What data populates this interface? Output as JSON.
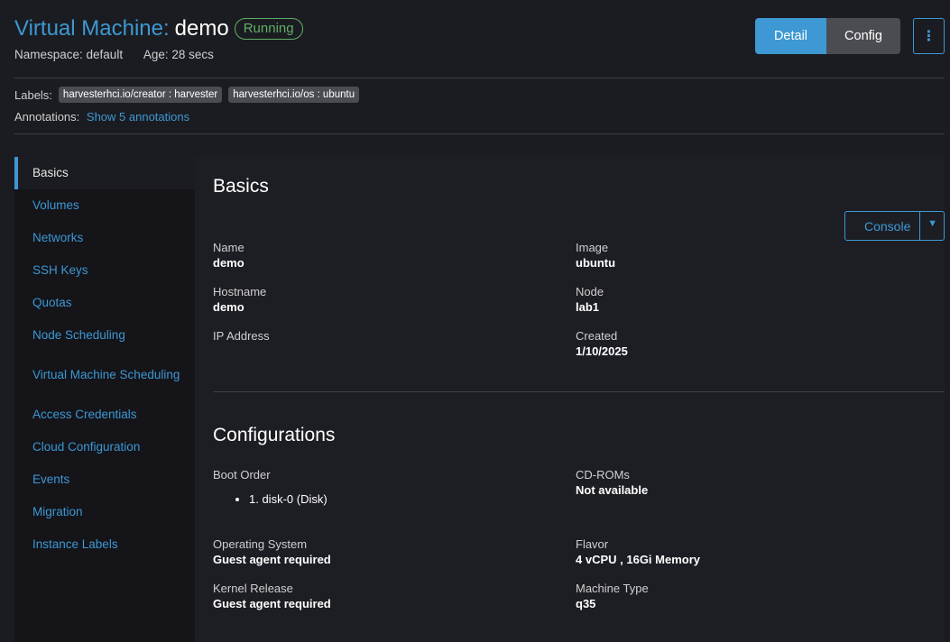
{
  "header": {
    "title_prefix": "Virtual Machine:",
    "title_name": "demo",
    "state": "Running",
    "namespace": "Namespace: default",
    "age": "Age: 28 secs"
  },
  "actions": {
    "detail": "Detail",
    "config": "Config",
    "more_icon": "⋮"
  },
  "labels": {
    "label": "Labels:",
    "chips": [
      "harvesterhci.io/creator : harvester",
      "harvesterhci.io/os : ubuntu"
    ]
  },
  "annotations": {
    "label": "Annotations:",
    "link": "Show 5 annotations"
  },
  "tabs": [
    "Basics",
    "Volumes",
    "Networks",
    "SSH Keys",
    "Quotas",
    "Node Scheduling",
    "Virtual Machine Scheduling",
    "Access Credentials",
    "Cloud Configuration",
    "Events",
    "Migration",
    "Instance Labels"
  ],
  "basics": {
    "title": "Basics",
    "console": "Console",
    "name_label": "Name",
    "name": "demo",
    "image_label": "Image",
    "image": "ubuntu",
    "hostname_label": "Hostname",
    "hostname": "demo",
    "node_label": "Node",
    "node": "lab1",
    "ip_label": "IP Address",
    "created_label": "Created",
    "created": "1/10/2025"
  },
  "configurations": {
    "title": "Configurations",
    "boot_label": "Boot Order",
    "boot_items": [
      "1. disk-0 (Disk)"
    ],
    "cdroms_label": "CD-ROMs",
    "cdroms": "Not available",
    "os_label": "Operating System",
    "os": "Guest agent required",
    "flavor_label": "Flavor",
    "flavor": "4 vCPU , 16Gi Memory",
    "kernel_label": "Kernel Release",
    "kernel": "Guest agent required",
    "machine_type_label": "Machine Type",
    "machine_type": "q35"
  },
  "colors": {
    "accent": "#3d98d3",
    "running": "#5fae66",
    "background": "#1b1c21"
  }
}
